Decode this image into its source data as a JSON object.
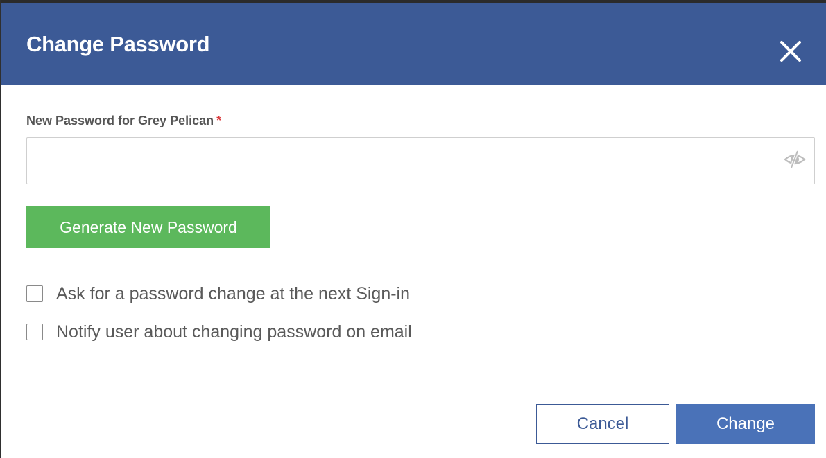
{
  "dialog": {
    "title": "Change Password",
    "close_icon": "close-icon"
  },
  "form": {
    "field_label": "New Password for Grey Pelican",
    "required_marker": "*",
    "password_value": "",
    "password_placeholder": "",
    "visibility_icon": "eye-slash-icon",
    "generate_label": "Generate New Password"
  },
  "options": [
    {
      "label": "Ask for a password change at the next Sign-in",
      "checked": false
    },
    {
      "label": "Notify user about changing password on email",
      "checked": false
    }
  ],
  "footer": {
    "cancel_label": "Cancel",
    "change_label": "Change"
  },
  "colors": {
    "header": "#3c5a96",
    "primary": "#4a72b8",
    "success": "#5cb85c",
    "required": "#d9383a"
  }
}
